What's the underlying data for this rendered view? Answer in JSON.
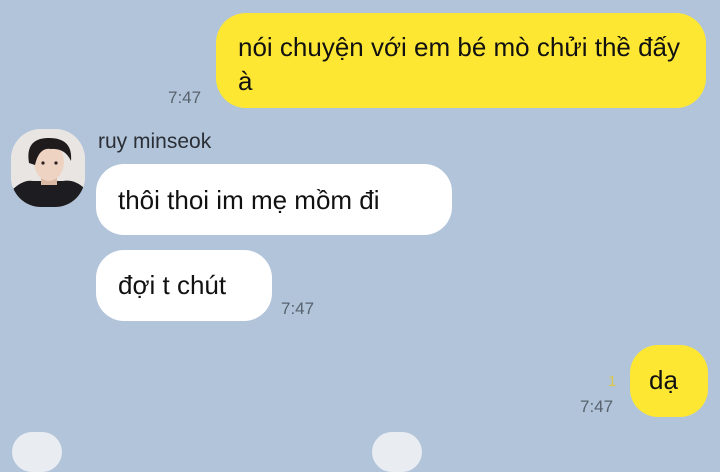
{
  "colors": {
    "background": "#b1c4da",
    "outgoing_bubble": "#fee733",
    "incoming_bubble": "#ffffff",
    "timestamp": "#59636e",
    "unread_count": "#d9c84a"
  },
  "messages": {
    "msg1": {
      "direction": "outgoing",
      "text": "nói chuyện với em bé mò chửi thề đấy à",
      "time": "7:47"
    },
    "sender": {
      "name": "ruy minseok",
      "avatar_icon": "profile-photo"
    },
    "msg2": {
      "direction": "incoming",
      "text": "thôi thoi im mẹ mồm đi"
    },
    "msg3": {
      "direction": "incoming",
      "text": "đợi t chút",
      "time": "7:47"
    },
    "msg4": {
      "direction": "outgoing",
      "text": "dạ",
      "time": "7:47",
      "unread": "1"
    }
  }
}
